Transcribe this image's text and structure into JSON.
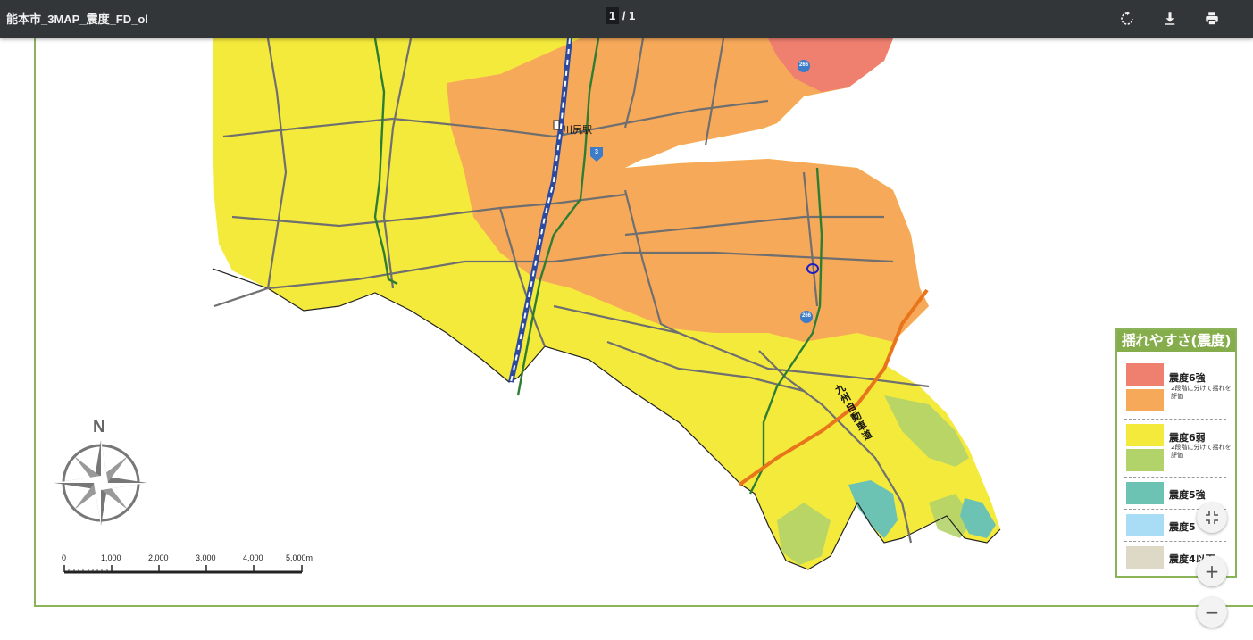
{
  "toolbar": {
    "title": "能本市_3MAP_震度_FD_ol",
    "page_current": "1",
    "page_separator": "/",
    "page_total": "1",
    "rotate_icon": "rotate-icon",
    "download_icon": "download-icon",
    "print_icon": "print-icon"
  },
  "map": {
    "station_label": "川尻駅",
    "expressway_label": "九州自動車道",
    "route_3": "3",
    "route_266_a": "266",
    "route_266_b": "266",
    "compass_n": "N",
    "scale_labels": [
      "0",
      "1,000",
      "2,000",
      "3,000",
      "4,000",
      "5,000m"
    ],
    "colors": {
      "intensity_6_upper_a": "#ef7f6f",
      "intensity_6_upper_b": "#f7a95a",
      "intensity_6_lower_a": "#f7ee3f",
      "intensity_6_lower_b": "#b2d36a",
      "intensity_5_upper": "#6cc2b3",
      "intensity_5_lower": "#a9dcf5",
      "intensity_4_or_less": "#ded9c7",
      "road": "#6f6f6f",
      "railway": "#2b4aa0",
      "green_line": "#2e7d32",
      "expressway": "#e8741c",
      "frame": "#8bb35a"
    }
  },
  "legend": {
    "title": "揺れやすさ(震度)",
    "items": [
      {
        "label": "震度6強",
        "note": "2段階に分けて揺れを評価"
      },
      {
        "label": "震度6弱",
        "note": "2段階に分けて揺れを評価"
      },
      {
        "label": "震度5強",
        "note": ""
      },
      {
        "label": "震度5",
        "note": ""
      },
      {
        "label": "震度4以下",
        "note": ""
      }
    ]
  },
  "viewer": {
    "fit_icon": "fit-to-page-icon",
    "zoom_in_label": "+",
    "zoom_out_label": "−"
  }
}
